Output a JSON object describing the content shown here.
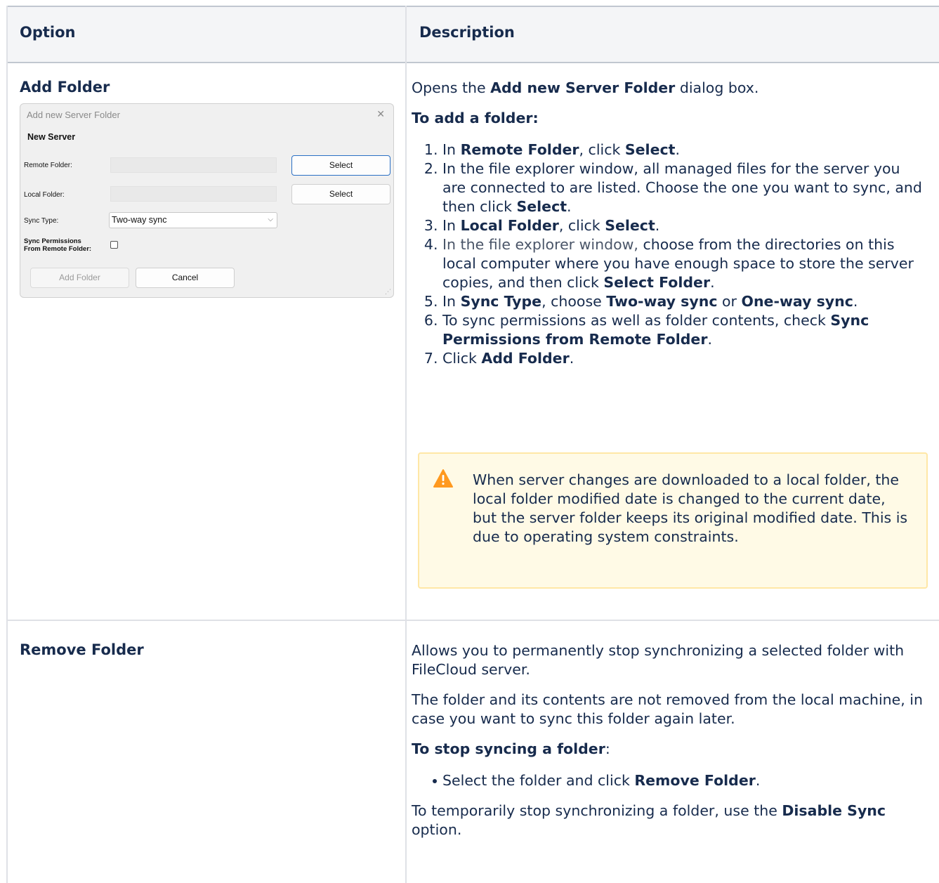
{
  "table": {
    "headers": {
      "option": "Option",
      "description": "Description"
    }
  },
  "rows": {
    "add_folder": {
      "title": "Add Folder",
      "intro_pre": "Opens the ",
      "intro_bold": "Add new Server Folder",
      "intro_post": " dialog box.",
      "howto": "To add a folder:",
      "steps": {
        "s1": {
          "a": "In ",
          "b": "Remote Folder",
          "c": ", click ",
          "d": "Select",
          "e": "."
        },
        "s2": {
          "a": "In the file explorer window, all managed files for the server you are connected to are listed. Choose the one you want to sync, and then click ",
          "b": "Select",
          "c": "."
        },
        "s3": {
          "a": "In ",
          "b": "Local Folder",
          "c": ", click ",
          "d": "Select",
          "e": "."
        },
        "s4": {
          "a": "In the file explorer window,",
          "b": " choose from the directories on this local computer where you have enough space to store the server copies, and then click ",
          "c": "Select Folder",
          "d": "."
        },
        "s5": {
          "a": "In ",
          "b": "Sync Type",
          "c": ", choose ",
          "d": "Two-way sync",
          "e": " or ",
          "f": "One-way sync",
          "g": "."
        },
        "s6": {
          "a": "To sync permissions as well as folder contents, check ",
          "b": "Sync Permissions from Remote Folder",
          "c": "."
        },
        "s7": {
          "a": "Click ",
          "b": "Add Folder",
          "c": "."
        }
      },
      "warning": "When server changes are downloaded to a local folder, the local folder modified date is changed to the current date, but the server folder keeps its original modified date. This is due to operating system constraints.",
      "warning_icon": "warning-triangle-icon",
      "warning_color": "#ff991f"
    },
    "remove_folder": {
      "title": "Remove Folder",
      "p1": "Allows you to permanently stop synchronizing a selected folder with FileCloud server.",
      "p2": "The folder and its contents are not removed from the local machine, in case you want to sync this folder again later.",
      "howto": "To stop syncing a folder",
      "howto_colon": ":",
      "bullet_pre": "Select the folder and click ",
      "bullet_bold": "Remove Folder",
      "bullet_post": ".",
      "p3_pre": "To temporarily stop synchronizing a folder, use the ",
      "p3_bold": "Disable Sync",
      "p3_post": " option."
    }
  },
  "dialog": {
    "title": "Add new Server Folder",
    "close_glyph": "✕",
    "heading": "New Server",
    "remote_label": "Remote Folder:",
    "local_label": "Local Folder:",
    "select_label": "Select",
    "sync_type_label": "Sync Type:",
    "sync_type_value": "Two-way sync",
    "perm_label_1": "Sync Permissions",
    "perm_label_2": "From Remote Folder:",
    "add_button": "Add Folder",
    "cancel_button": "Cancel",
    "chevron": "⌵"
  }
}
